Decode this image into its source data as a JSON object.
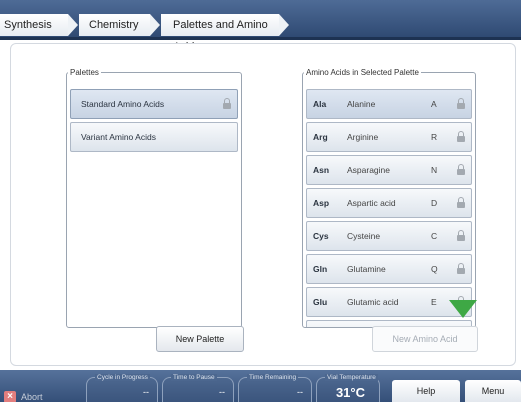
{
  "breadcrumb": {
    "items": [
      "Synthesis",
      "Chemistry",
      "Palettes and Amino Acids"
    ]
  },
  "palettes": {
    "legend": "Palettes",
    "items": [
      {
        "label": "Standard Amino Acids",
        "locked": true,
        "selected": true
      },
      {
        "label": "Variant Amino Acids",
        "locked": false,
        "selected": false
      }
    ],
    "new_button": "New Palette"
  },
  "amino_acids": {
    "legend": "Amino Acids in Selected Palette",
    "rows": [
      {
        "abbr": "Ala",
        "name": "Alanine",
        "code": "A",
        "locked": true
      },
      {
        "abbr": "Arg",
        "name": "Arginine",
        "code": "R",
        "locked": true
      },
      {
        "abbr": "Asn",
        "name": "Asparagine",
        "code": "N",
        "locked": true
      },
      {
        "abbr": "Asp",
        "name": "Aspartic acid",
        "code": "D",
        "locked": true
      },
      {
        "abbr": "Cys",
        "name": "Cysteine",
        "code": "C",
        "locked": true
      },
      {
        "abbr": "Gln",
        "name": "Glutamine",
        "code": "Q",
        "locked": true
      },
      {
        "abbr": "Glu",
        "name": "Glutamic acid",
        "code": "E",
        "locked": true
      }
    ],
    "new_button": "New Amino Acid",
    "scroll_icon": "down-arrow-icon"
  },
  "statusbar": {
    "abort_label": "Abort",
    "cycle_label": "Cycle in Progress",
    "cycle_value": "--",
    "pause_label": "Time to Pause",
    "pause_value": "--",
    "remaining_label": "Time Remaining",
    "remaining_value": "--",
    "vial_label": "Vial Temperature",
    "vial_value": "31°C",
    "help_label": "Help",
    "menu_label": "Menu"
  },
  "colors": {
    "header": "#3c5a85",
    "accent_arrow": "#3ea845",
    "abort": "#e37e7e"
  }
}
